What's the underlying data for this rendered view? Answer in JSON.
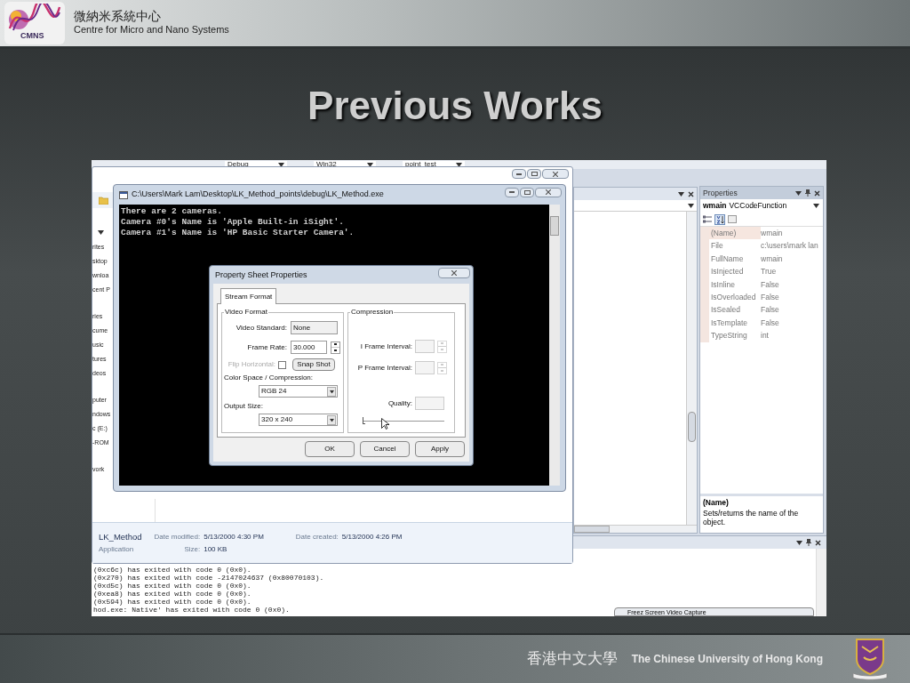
{
  "header": {
    "logo_text": "CMNS",
    "name_zh": "微納米系統中心",
    "name_en": "Centre for Micro and Nano Systems"
  },
  "title": "Previous Works",
  "screenshot": {
    "toolbar": {
      "combos": [
        {
          "value": "Debug"
        },
        {
          "value": "Win32"
        },
        {
          "value": "point_test"
        }
      ]
    },
    "explorer": {
      "sidebar_groups": [
        {
          "items": [
            "rites",
            "sktop",
            "wnloa",
            "cent P"
          ]
        },
        {
          "items": [
            "ries",
            "cume",
            "usic",
            "tures",
            "deos"
          ]
        },
        {
          "items": [
            "puter",
            "ndows",
            "c (E:)",
            "-ROM"
          ]
        },
        {
          "items": [
            "vork"
          ]
        }
      ],
      "details": {
        "name": "LK_Method",
        "type": "Application",
        "columns": [
          [
            {
              "label": "Date modified:",
              "value": "5/13/2000 4:30 PM"
            },
            {
              "label": "Size:",
              "value": "100 KB"
            }
          ],
          [
            {
              "label": "Date created:",
              "value": "5/13/2000 4:26 PM"
            }
          ]
        ]
      }
    },
    "console": {
      "title": "C:\\Users\\Mark Lam\\Desktop\\LK_Method_points\\debug\\LK_Method.exe",
      "lines": [
        "There are 2 cameras.",
        "Camera #0's Name is 'Apple Built-in iSight'.",
        "Camera #1's Name is 'HP Basic Starter Camera'."
      ]
    },
    "dialog": {
      "title": "Property Sheet Properties",
      "tabs": [
        {
          "label": "Stream Format",
          "selected": true
        }
      ],
      "video_format": {
        "label": "Video Format",
        "video_standard": {
          "label": "Video Standard:",
          "value": "None"
        },
        "frame_rate": {
          "label": "Frame Rate:",
          "value": "30.000"
        },
        "flip_horizontal": {
          "label": "Flip Horizontal:",
          "checked": false,
          "disabled": true
        },
        "snap_shot": "Snap Shot",
        "color_space": {
          "label": "Color Space / Compression:",
          "value": "RGB 24"
        },
        "output_size": {
          "label": "Output Size:",
          "value": "320 x 240"
        }
      },
      "compression": {
        "label": "Compression",
        "i_frame": {
          "label": "I Frame Interval:"
        },
        "p_frame": {
          "label": "P Frame Interval:"
        },
        "quality": {
          "label": "Quality:",
          "level": 0
        }
      },
      "buttons": [
        "OK",
        "Cancel",
        "Apply"
      ]
    },
    "properties": {
      "title": "Properties",
      "object_name": "wmain",
      "object_type": "VCCodeFunction",
      "rows": [
        {
          "name": "(Name)",
          "value": "wmain",
          "selected": true
        },
        {
          "name": "File",
          "value": "c:\\users\\mark lan",
          "selected": false
        },
        {
          "name": "FullName",
          "value": "wmain",
          "selected": false
        },
        {
          "name": "IsInjected",
          "value": "True",
          "selected": false
        },
        {
          "name": "IsInline",
          "value": "False",
          "selected": false
        },
        {
          "name": "IsOverloaded",
          "value": "False",
          "selected": false
        },
        {
          "name": "IsSealed",
          "value": "False",
          "selected": false
        },
        {
          "name": "IsTemplate",
          "value": "False",
          "selected": false
        },
        {
          "name": "TypeString",
          "value": "int",
          "selected": false
        }
      ],
      "description": {
        "title": "(Name)",
        "text": "Sets/returns the name of the object."
      }
    },
    "output": {
      "lines": [
        "(0xc6c) has exited with code 0 (0x0).",
        "(0x270) has exited with code -2147024637 (0x80070103).",
        "(0xd5c) has exited with code 0 (0x0).",
        "(0xea8) has exited with code 0 (0x0).",
        "(0x594) has exited with code 0 (0x0).",
        "hod.exe: Native' has exited with code 0 (0x0)."
      ]
    },
    "taskbar_tab": "Freez Screen Video Capture"
  },
  "footer": {
    "name_zh": "香港中文大學",
    "name_en": "The Chinese University of Hong Kong"
  }
}
